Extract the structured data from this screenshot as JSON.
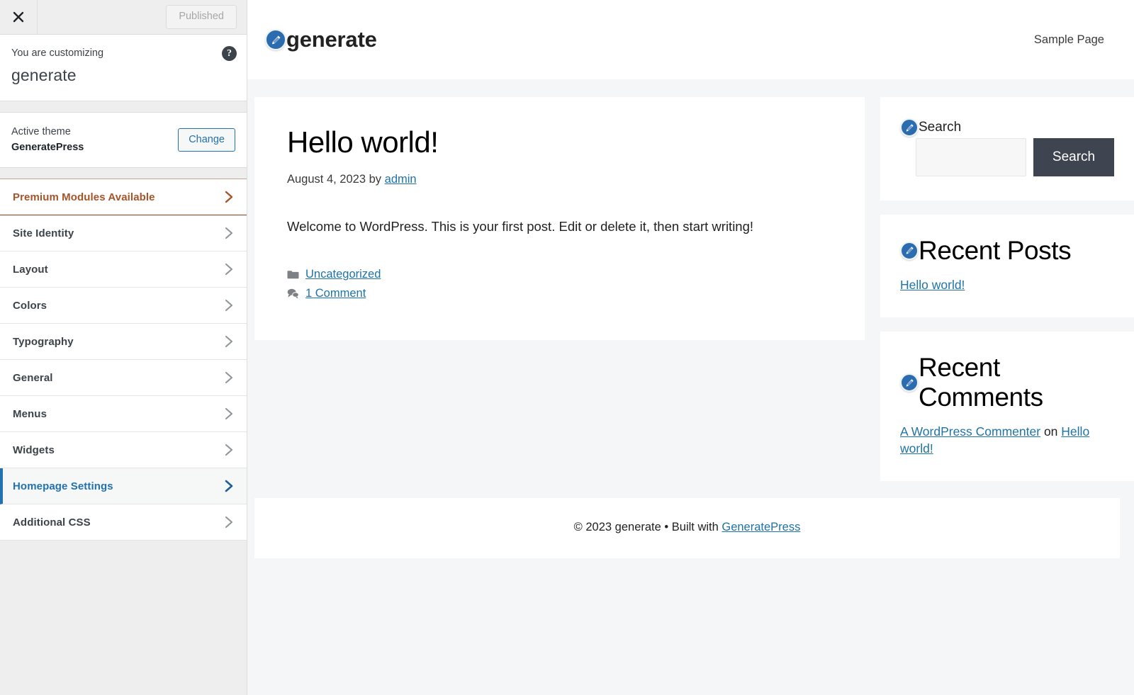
{
  "customizer": {
    "close_label": "Close customizer",
    "publish_button": "Published",
    "intro_label": "You are customizing",
    "site_title": "generate",
    "help_label": "?",
    "theme": {
      "active_label": "Active theme",
      "name": "GeneratePress",
      "change_button": "Change"
    },
    "sections": [
      {
        "label": "Premium Modules Available",
        "state": "premium"
      },
      {
        "label": "Site Identity",
        "state": "normal"
      },
      {
        "label": "Layout",
        "state": "normal"
      },
      {
        "label": "Colors",
        "state": "normal"
      },
      {
        "label": "Typography",
        "state": "normal"
      },
      {
        "label": "General",
        "state": "normal"
      },
      {
        "label": "Menus",
        "state": "normal"
      },
      {
        "label": "Widgets",
        "state": "normal"
      },
      {
        "label": "Homepage Settings",
        "state": "active"
      },
      {
        "label": "Additional CSS",
        "state": "normal"
      }
    ],
    "colors": {
      "accent_blue": "#2271b1",
      "premium_brown": "#a6542a",
      "panel_bg": "#eeeeee"
    }
  },
  "preview": {
    "header": {
      "site_title": "generate",
      "nav": [
        {
          "label": "Sample Page"
        }
      ]
    },
    "post": {
      "title": "Hello world!",
      "meta_date": "August 4, 2023",
      "meta_by": "by",
      "meta_author": "admin",
      "content": "Welcome to WordPress. This is your first post. Edit or delete it, then start writing!",
      "category": "Uncategorized",
      "comments": "1 Comment"
    },
    "widgets": {
      "search": {
        "title": "Search",
        "input_value": "",
        "input_placeholder": "",
        "button_label": "Search"
      },
      "recent_posts": {
        "title": "Recent Posts",
        "items": [
          {
            "label": "Hello world!"
          }
        ]
      },
      "recent_comments": {
        "title": "Recent Comments",
        "items": [
          {
            "author": "A WordPress Commenter",
            "joiner": "on",
            "post": "Hello world!"
          }
        ]
      }
    },
    "footer": {
      "copyright": "© 2023 generate • Built with",
      "link": "GeneratePress"
    },
    "colors": {
      "link_blue": "#1e73a8",
      "button_dark": "#3f4451",
      "page_bg": "#f5f6f8"
    }
  }
}
